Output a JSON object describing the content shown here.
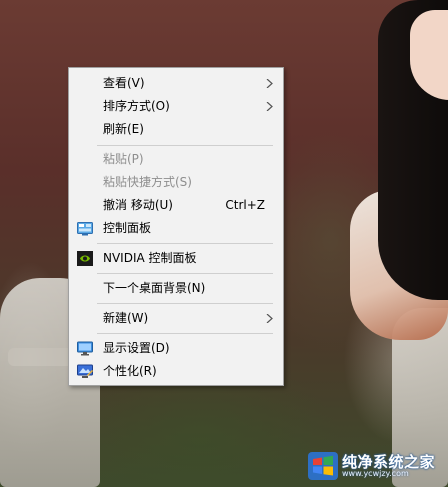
{
  "menu": {
    "items": [
      {
        "label": "查看(V)",
        "submenu": true
      },
      {
        "label": "排序方式(O)",
        "submenu": true
      },
      {
        "label": "刷新(E)"
      },
      {
        "label": "粘贴(P)",
        "disabled": true
      },
      {
        "label": "粘贴快捷方式(S)",
        "disabled": true
      },
      {
        "label": "撤消 移动(U)",
        "shortcut": "Ctrl+Z"
      },
      {
        "label": "控制面板",
        "icon": "control-panel-icon"
      },
      {
        "label": "NVIDIA 控制面板",
        "icon": "nvidia-icon"
      },
      {
        "label": "下一个桌面背景(N)"
      },
      {
        "label": "新建(W)",
        "submenu": true
      },
      {
        "label": "显示设置(D)",
        "icon": "display-icon"
      },
      {
        "label": "个性化(R)",
        "icon": "personalize-icon"
      }
    ]
  },
  "watermark": {
    "title": "纯净系统之家",
    "url": "www.ycwjzy.com"
  },
  "colors": {
    "menu_bg": "#f2f2f2",
    "menu_border": "#a0a0a0",
    "disabled_text": "#8e8e8e",
    "nvidia_green": "#76b900"
  }
}
